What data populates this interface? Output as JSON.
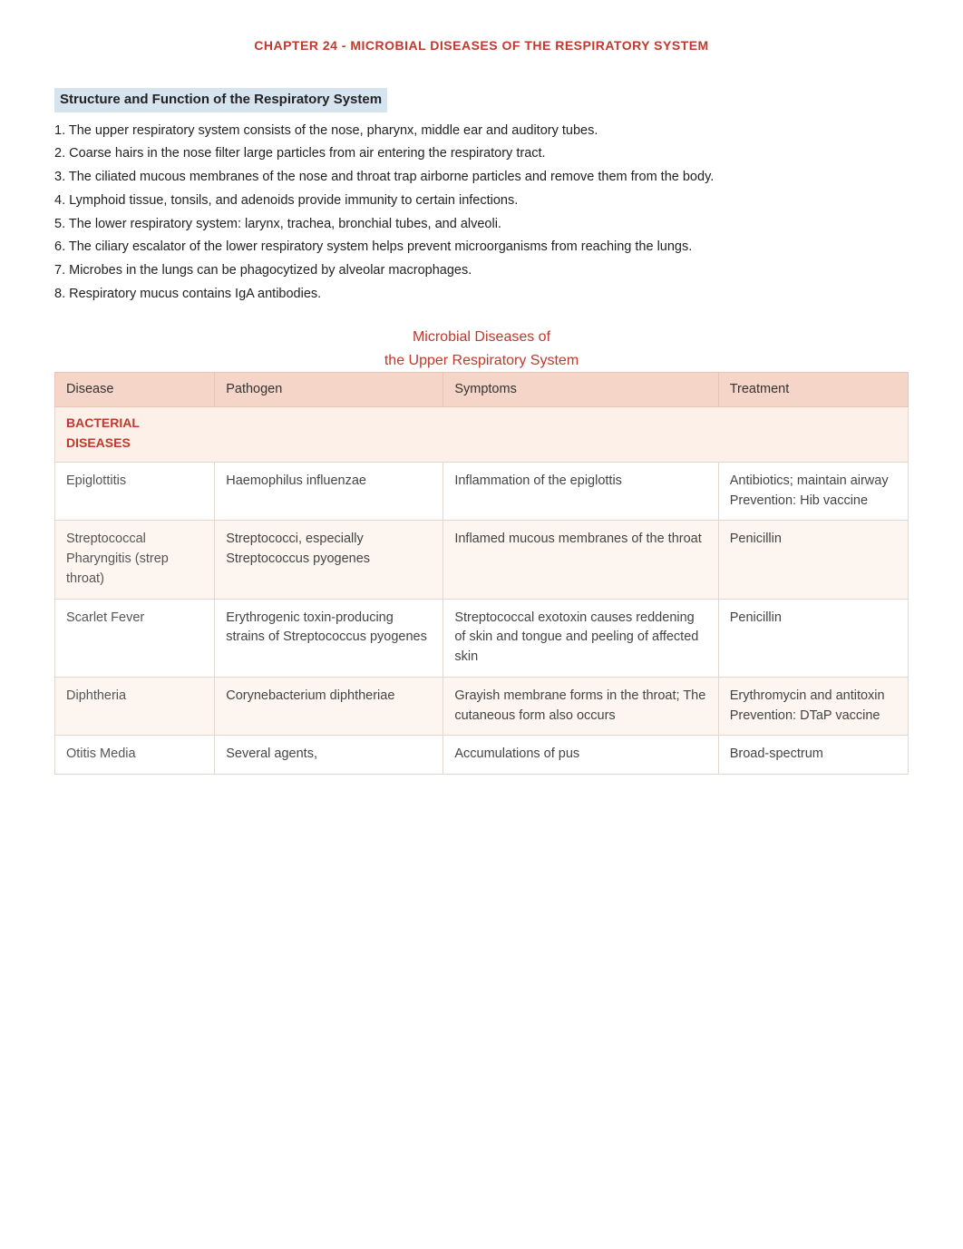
{
  "chapter": {
    "title": "CHAPTER 24 - MICROBIAL DISEASES OF THE RESPIRATORY SYSTEM"
  },
  "section": {
    "heading": "Structure and Function of the Respiratory System",
    "points": [
      "1. The upper respiratory system consists of the nose, pharynx, middle ear and auditory tubes.",
      "2. Coarse hairs in the nose filter large particles from air entering the respiratory tract.",
      "3. The ciliated mucous membranes of the nose and throat trap airborne particles and remove them from the body.",
      "4. Lymphoid tissue, tonsils, and adenoids provide immunity to certain infections.",
      "5. The lower respiratory system: larynx, trachea, bronchial tubes, and alveoli.",
      "6. The ciliary escalator of the lower respiratory system helps prevent microorganisms from reaching the lungs.",
      "7. Microbes in the lungs can be phagocytized by alveolar macrophages.",
      "8. Respiratory mucus contains IgA antibodies."
    ]
  },
  "table": {
    "title_line1": "Microbial Diseases of",
    "title_line2": "the Upper Respiratory System",
    "headers": [
      "Disease",
      "Pathogen",
      "Symptoms",
      "Treatment"
    ],
    "bacterial_label": "BACTERIAL\nDISEASES",
    "rows": [
      {
        "disease": "Epiglottitis",
        "pathogen": "Haemophilus influenzae",
        "symptoms": "Inflammation of the epiglottis",
        "treatment": "Antibiotics; maintain airway\nPrevention: Hib vaccine"
      },
      {
        "disease": "Streptococcal Pharyngitis\n(strep throat)",
        "pathogen": "Streptococci, especially Streptococcus pyogenes",
        "symptoms": "Inflamed mucous membranes of the throat",
        "treatment": "Penicillin"
      },
      {
        "disease": "Scarlet Fever",
        "pathogen": "Erythrogenic toxin-producing strains of Streptococcus pyogenes",
        "symptoms": "Streptococcal exotoxin causes reddening of skin and tongue and peeling of affected skin",
        "treatment": "Penicillin"
      },
      {
        "disease": "Diphtheria",
        "pathogen": "Corynebacterium diphtheriae",
        "symptoms": "Grayish membrane forms in the throat; The cutaneous form also occurs",
        "treatment": "Erythromycin and antitoxin\nPrevention: DTaP vaccine"
      },
      {
        "disease": "Otitis Media",
        "pathogen": "Several agents,",
        "symptoms": "Accumulations of pus",
        "treatment": "Broad-spectrum"
      }
    ]
  }
}
